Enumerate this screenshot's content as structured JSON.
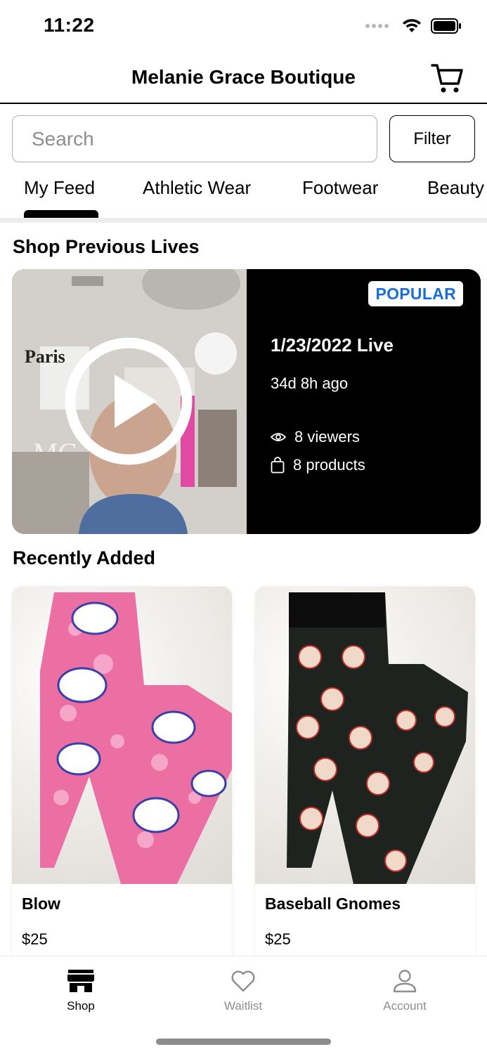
{
  "status_bar": {
    "time": "11:22"
  },
  "header": {
    "title": "Melanie Grace Boutique",
    "cart_icon": "cart-icon"
  },
  "search": {
    "placeholder": "Search",
    "filter_label": "Filter"
  },
  "tabs": [
    {
      "label": "My Feed",
      "active": true
    },
    {
      "label": "Athletic Wear",
      "active": false
    },
    {
      "label": "Footwear",
      "active": false
    },
    {
      "label": "Beauty",
      "active": false
    }
  ],
  "previous_lives": {
    "title": "Shop Previous Lives",
    "card": {
      "badge": "POPULAR",
      "title": "1/23/2022 Live",
      "ago": "34d 8h ago",
      "viewers": "8 viewers",
      "products": "8 products"
    }
  },
  "recently_added": {
    "title": "Recently Added",
    "products": [
      {
        "name": "Blow",
        "price": "$25"
      },
      {
        "name": "Baseball Gnomes",
        "price": "$25"
      }
    ]
  },
  "tab_bar": {
    "items": [
      {
        "label": "Shop",
        "icon": "store-icon",
        "active": true
      },
      {
        "label": "Waitlist",
        "icon": "heart-icon",
        "active": false
      },
      {
        "label": "Account",
        "icon": "person-icon",
        "active": false
      }
    ]
  },
  "colors": {
    "badge_text": "#1a6fd6",
    "inactive_tab": "#8e8e8e",
    "live_background": "#000000"
  }
}
